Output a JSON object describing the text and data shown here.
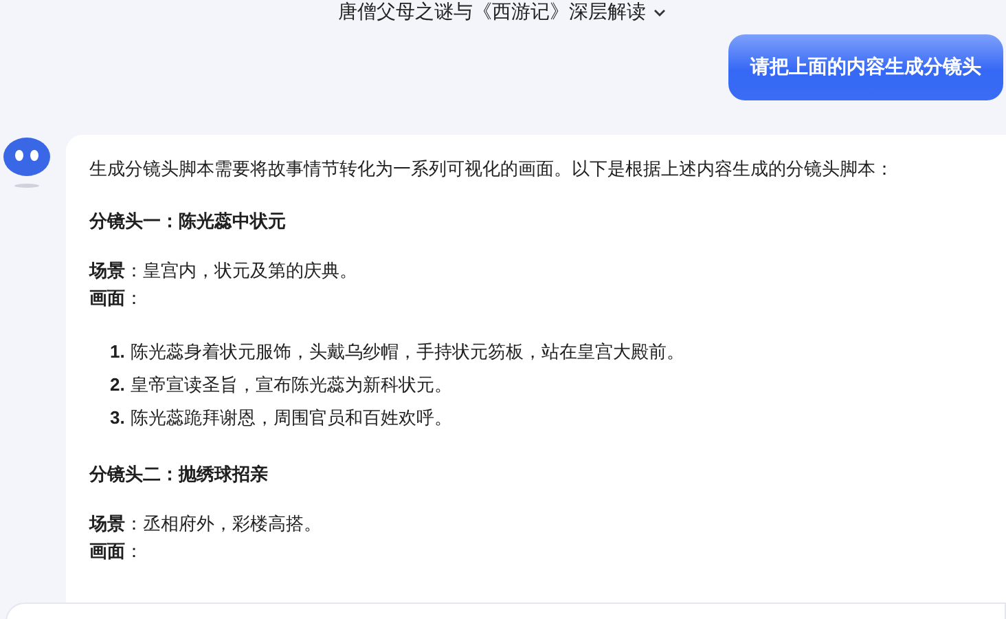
{
  "header": {
    "title": "唐僧父母之谜与《西游记》深层解读"
  },
  "user_message": {
    "text": "请把上面的内容生成分镜头"
  },
  "reply": {
    "blocks": [
      {
        "kind": "paragraph",
        "text": "生成分镜头脚本需要将故事情节转化为一系列可视化的画面。以下是根据上述内容生成的分镜头脚本："
      },
      {
        "kind": "heading",
        "text": "分镜头一：陈光蕊中状元"
      },
      {
        "kind": "field",
        "text": "**场景**：皇宫内，状元及第的庆典。"
      },
      {
        "kind": "field",
        "text": "**画面**："
      },
      {
        "kind": "list",
        "items": [
          {
            "number": "1.",
            "text": "陈光蕊身着状元服饰，头戴乌纱帽，手持状元笏板，站在皇宫大殿前。"
          },
          {
            "number": "2.",
            "text": "皇帝宣读圣旨，宣布陈光蕊为新科状元。"
          },
          {
            "number": "3.",
            "text": "陈光蕊跪拜谢恩，周围官员和百姓欢呼。"
          }
        ]
      },
      {
        "kind": "heading",
        "text": "分镜头二：抛绣球招亲"
      },
      {
        "kind": "field",
        "text": "**场景**：丞相府外，彩楼高搭。"
      },
      {
        "kind": "field",
        "text": "**画面**："
      }
    ]
  }
}
